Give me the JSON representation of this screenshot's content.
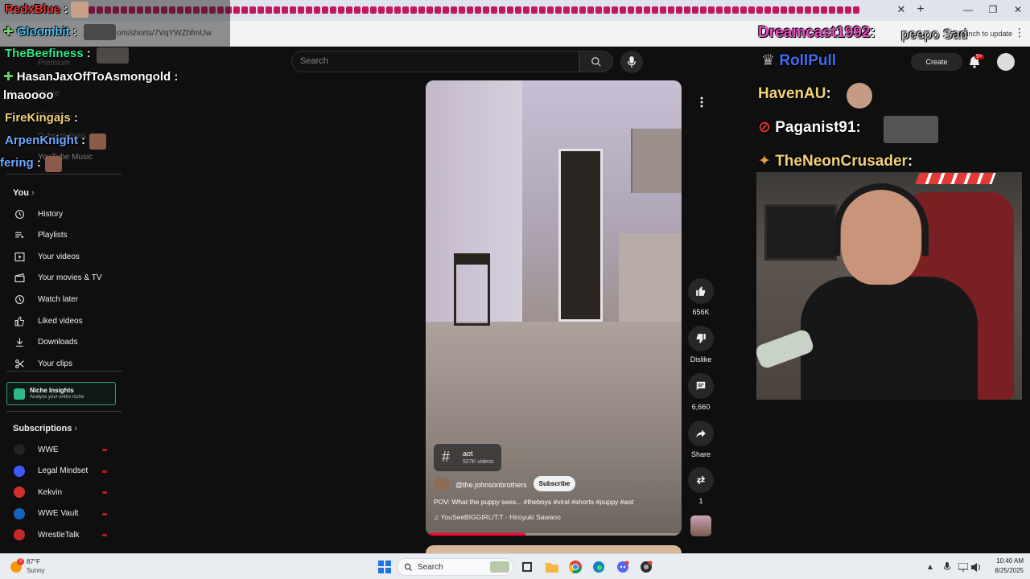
{
  "browser": {
    "url": "om/shorts/7VqYWZhfmUw",
    "update_label": "Relaunch to update"
  },
  "youtube": {
    "search_placeholder": "Search",
    "create_label": "Create",
    "notif_badge": "9+"
  },
  "sidebar": {
    "you_heading": "You",
    "overlapped_items": [
      "Premium",
      "Home",
      "Shorts",
      "Subscriptions",
      "YouTube Music"
    ],
    "you_items": [
      {
        "label": "History",
        "icon": "history-icon"
      },
      {
        "label": "Playlists",
        "icon": "playlists-icon"
      },
      {
        "label": "Your videos",
        "icon": "your-videos-icon"
      },
      {
        "label": "Your movies & TV",
        "icon": "movies-icon"
      },
      {
        "label": "Watch later",
        "icon": "clock-icon"
      },
      {
        "label": "Liked videos",
        "icon": "thumbs-up-icon"
      },
      {
        "label": "Downloads",
        "icon": "download-icon"
      },
      {
        "label": "Your clips",
        "icon": "scissors-icon"
      }
    ],
    "niche": {
      "title": "Niche Insights",
      "subtitle": "Analyze your entire niche"
    },
    "subscriptions_heading": "Subscriptions",
    "subscriptions": [
      {
        "label": "WWE",
        "color": "#222222"
      },
      {
        "label": "Legal Mindset",
        "color": "#3d5afe"
      },
      {
        "label": "Kekvin",
        "color": "#d32f2f"
      },
      {
        "label": "WWE Vault",
        "color": "#1565c0"
      },
      {
        "label": "WrestleTalk",
        "color": "#c62828"
      }
    ]
  },
  "short": {
    "hashtag": "aot",
    "hashtag_count": "527K videos",
    "channel": "@the.johnsonbrothers",
    "subscribe_label": "Subscribe",
    "caption": "POV: What the puppy sees... #theboys #viral #shorts #puppy #aot",
    "music": "YouSeeBIGGIRL/T:T · Hiroyuki Sawano",
    "progress": 0.39
  },
  "actions": {
    "likes": "656K",
    "dislike_label": "Dislike",
    "comments": "6,660",
    "share_label": "Share",
    "remix_count": "1"
  },
  "stream_chat": {
    "left": [
      {
        "user": "RedxBlue",
        "color": "#e53935"
      },
      {
        "user": "Gloombit",
        "color": "#4fc3f7"
      },
      {
        "user": "TheBeefiness",
        "color": "#2ee88a"
      },
      {
        "user": "HasanJaxOffToAsmongold",
        "color": "#ffffff"
      },
      {
        "message": "lmaoooo",
        "color": "#ffffff"
      },
      {
        "user": "FireKingajs",
        "color": "#f3d27a"
      },
      {
        "user": "ArpenKnight",
        "color": "#6fa8ff"
      },
      {
        "user": "fering",
        "color": "#6fa8ff"
      }
    ],
    "right": [
      {
        "user": "Dreamcast1992",
        "color": "#e64fc4"
      },
      {
        "message": "peepo Sad",
        "color": "#dddddd"
      },
      {
        "user": "RollPull",
        "color": "#3f6df0"
      },
      {
        "user": "HavenAU",
        "color": "#f3d27a"
      },
      {
        "user": "Paganist91",
        "color": "#ffffff"
      },
      {
        "user": "TheNeonCrusader",
        "color": "#f3d27a"
      }
    ]
  },
  "taskbar": {
    "temperature": "87°F",
    "condition": "Sunny",
    "weather_badge": "2",
    "search_label": "Search",
    "time": "10:40 AM",
    "date": "8/25/2025"
  }
}
